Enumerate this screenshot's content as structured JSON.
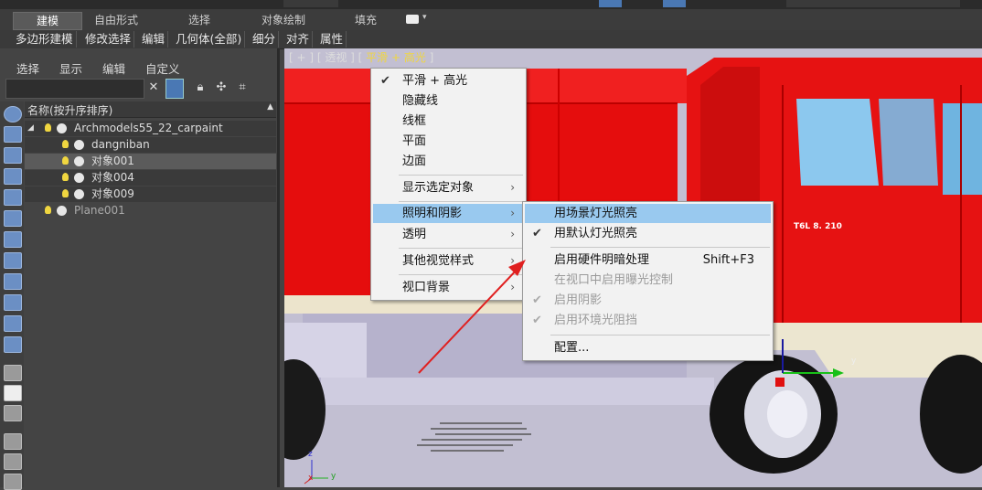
{
  "ribbon": {
    "tabs": [
      "建模",
      "自由形式",
      "选择",
      "对象绘制",
      "填充"
    ],
    "subtabs": [
      "多边形建模",
      "修改选择",
      "编辑",
      "几何体(全部)",
      "细分",
      "对齐",
      "属性"
    ]
  },
  "explorer": {
    "menu": [
      "选择",
      "显示",
      "编辑",
      "自定义"
    ],
    "header": "名称(按升序排序)",
    "header_arrow": "▲",
    "rows": [
      {
        "label": "Archmodels55_22_carpaint"
      },
      {
        "label": "dangniban"
      },
      {
        "label": "对象001"
      },
      {
        "label": "对象004"
      },
      {
        "label": "对象009"
      },
      {
        "label": "Plane001"
      }
    ]
  },
  "viewport": {
    "label_prefix": "[ + ] [ 透视 ] [ ",
    "label_shading": "平滑 + 高光",
    "label_suffix": " ]",
    "truck_plate": "T6L 8. 210",
    "axis_x": "x",
    "axis_y": "y",
    "axis_z": "z"
  },
  "main_menu": {
    "items": [
      {
        "label": "平滑 + 高光",
        "checked": "✔"
      },
      {
        "label": "隐藏线"
      },
      {
        "label": "线框"
      },
      {
        "label": "平面"
      },
      {
        "label": "边面"
      },
      {
        "label": "显示选定对象",
        "submenu": "›"
      },
      {
        "label": "照明和阴影",
        "submenu": "›"
      },
      {
        "label": "透明",
        "submenu": "›"
      },
      {
        "label": "其他视觉样式",
        "submenu": "›"
      },
      {
        "label": "视口背景",
        "submenu": "›"
      }
    ]
  },
  "lighting_menu": {
    "items": [
      {
        "label": "用场景灯光照亮"
      },
      {
        "label": "用默认灯光照亮",
        "checked": "✔"
      },
      {
        "label": "启用硬件明暗处理",
        "shortcut": "Shift+F3"
      },
      {
        "label": "在视口中启用曝光控制"
      },
      {
        "label": "启用阴影",
        "checked": "✔"
      },
      {
        "label": "启用环境光阻挡",
        "checked": "✔"
      },
      {
        "label": "配置..."
      }
    ]
  },
  "colors": {
    "truck_red": "#e60f0f",
    "menu_hover": "#99c9ef",
    "annotation_arrow": "#e02020"
  }
}
